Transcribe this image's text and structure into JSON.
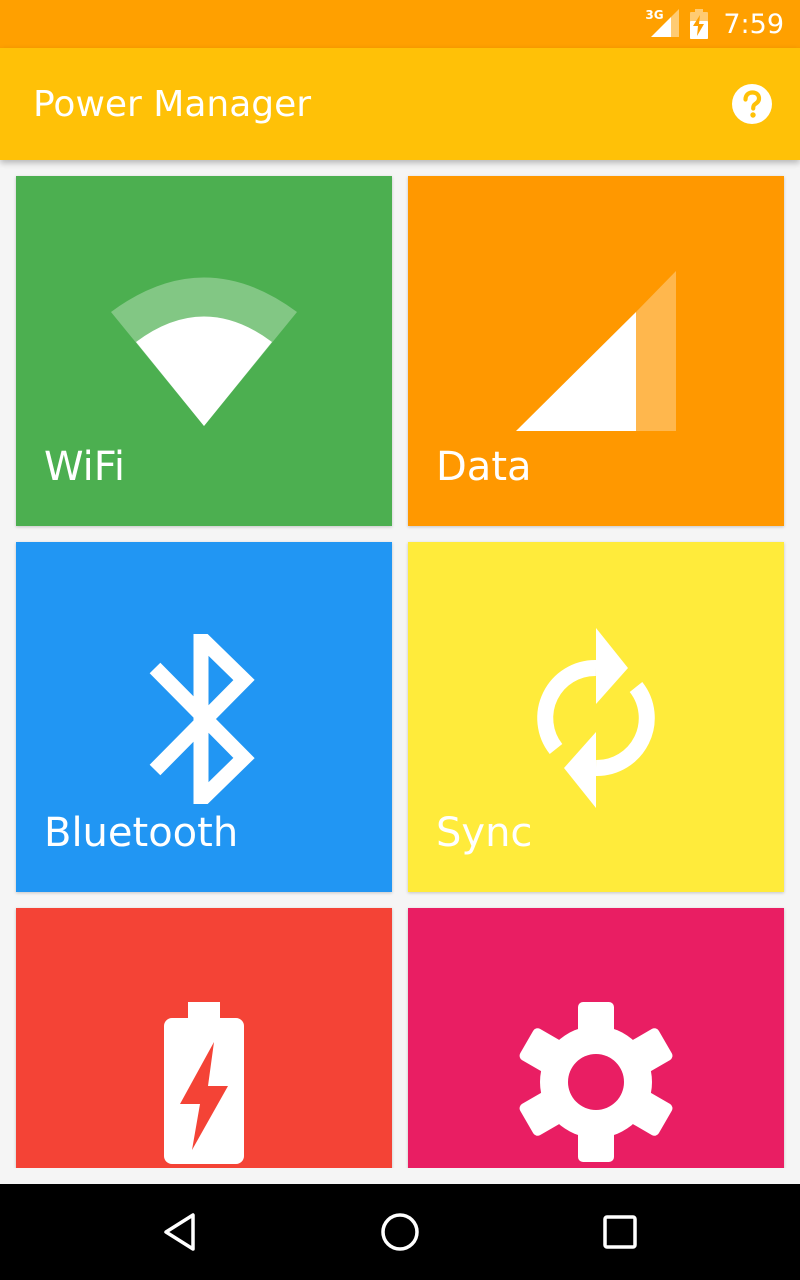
{
  "status_bar": {
    "network_type": "3G",
    "time": "7:59",
    "color": "#ffa000"
  },
  "app_bar": {
    "title": "Power Manager",
    "help_icon": "help-circle-icon",
    "color": "#ffc107"
  },
  "tiles": [
    {
      "label": "WiFi",
      "icon": "wifi-icon",
      "color": "#4caf50"
    },
    {
      "label": "Data",
      "icon": "cellular-data-icon",
      "color": "#ff9800"
    },
    {
      "label": "Bluetooth",
      "icon": "bluetooth-icon",
      "color": "#2196f3"
    },
    {
      "label": "Sync",
      "icon": "sync-icon",
      "color": "#ffeb3b"
    },
    {
      "label": "",
      "icon": "battery-charging-icon",
      "color": "#f44336"
    },
    {
      "label": "",
      "icon": "settings-gear-icon",
      "color": "#e91e63"
    }
  ],
  "nav_bar": {
    "buttons": [
      "back-icon",
      "home-icon",
      "recents-icon"
    ]
  }
}
